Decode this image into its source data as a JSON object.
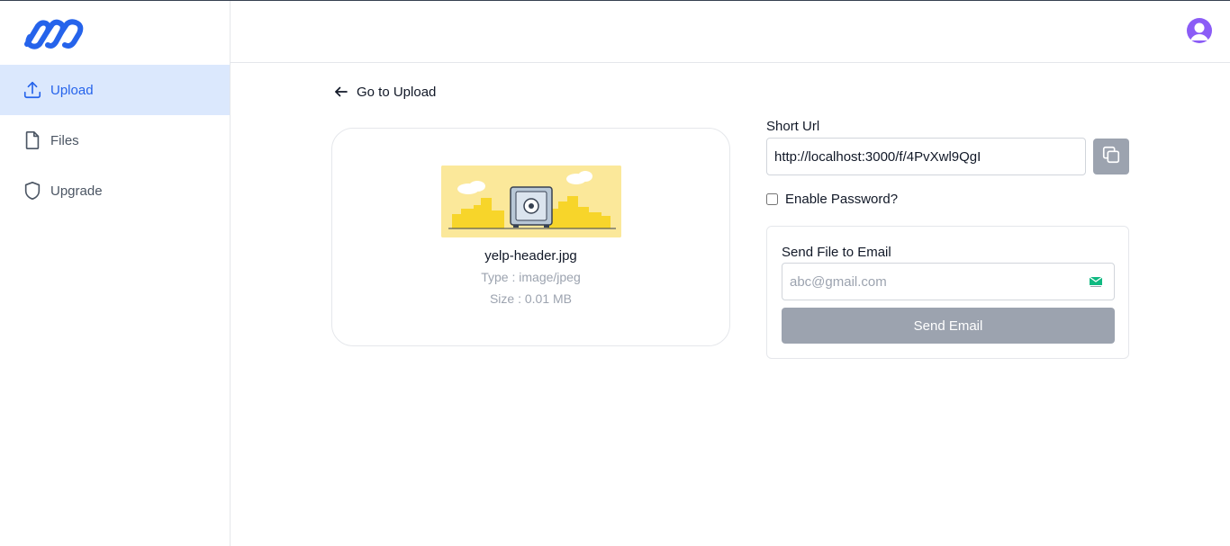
{
  "colors": {
    "accent": "#2563eb",
    "active_nav_bg": "#dbe8fd",
    "button_gray": "#9ca3af",
    "avatar": "#8b5cf6"
  },
  "sidebar": {
    "logo_icon": "infinity-logo-icon",
    "items": [
      {
        "label": "Upload",
        "icon": "upload-icon",
        "active": true
      },
      {
        "label": "Files",
        "icon": "file-icon",
        "active": false
      },
      {
        "label": "Upgrade",
        "icon": "shield-icon",
        "active": false
      }
    ]
  },
  "header": {
    "avatar_icon": "user-avatar-icon"
  },
  "back_link": {
    "label": "Go to Upload",
    "icon": "arrow-left-icon"
  },
  "file": {
    "name": "yelp-header.jpg",
    "type": "Type : image/jpeg",
    "size": "Size : 0.01 MB"
  },
  "share": {
    "short_url_label": "Short Url",
    "short_url_value": "http://localhost:3000/f/4PvXwl9QgI",
    "copy_icon": "copy-icon",
    "password_label": "Enable Password?",
    "password_checked": false
  },
  "email": {
    "label": "Send File to Email",
    "placeholder": "abc@gmail.com",
    "icon": "mail-icon",
    "button_label": "Send Email"
  }
}
